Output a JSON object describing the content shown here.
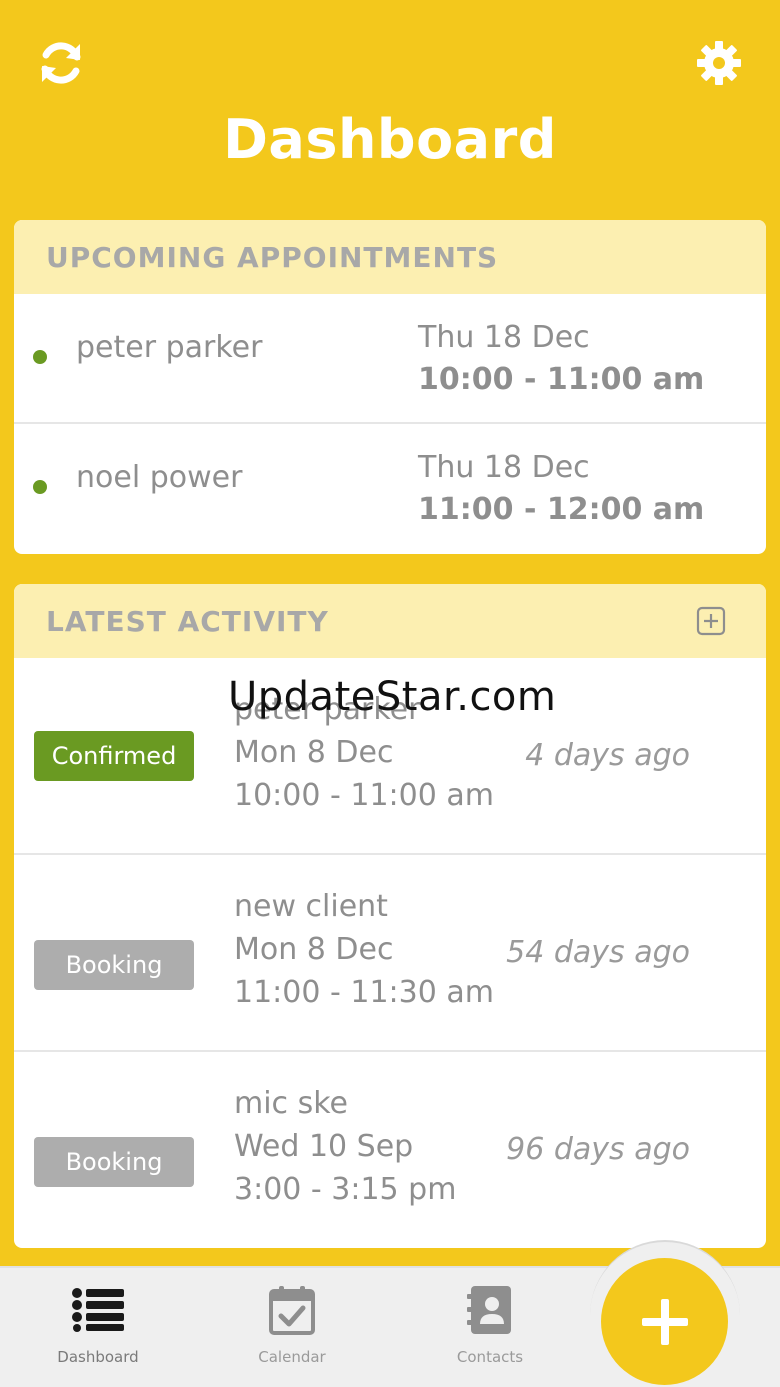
{
  "header": {
    "title": "Dashboard",
    "refresh_icon": "refresh-icon",
    "settings_icon": "gear-icon"
  },
  "appointments": {
    "title": "UPCOMING APPOINTMENTS",
    "items": [
      {
        "name": "peter parker",
        "date": "Thu 18 Dec",
        "time": "10:00 - 11:00 am"
      },
      {
        "name": "noel power",
        "date": "Thu 18 Dec",
        "time": "11:00 - 12:00 am"
      }
    ]
  },
  "activity": {
    "title": "LATEST ACTIVITY",
    "add_icon": "plus-square-icon",
    "items": [
      {
        "status": "Confirmed",
        "name": "peter parker",
        "date": "Mon 8 Dec",
        "time": "10:00 - 11:00 am",
        "ago": "4 days ago"
      },
      {
        "status": "Booking",
        "name": "new client",
        "date": "Mon 8 Dec",
        "time": "11:00 - 11:30 am",
        "ago": "54 days ago"
      },
      {
        "status": "Booking",
        "name": "mic ske",
        "date": "Wed 10 Sep",
        "time": "3:00 - 3:15 pm",
        "ago": "96 days ago"
      }
    ]
  },
  "watermark": "UpdateStar.com",
  "tabs": [
    {
      "label": "Dashboard",
      "icon": "list-icon"
    },
    {
      "label": "Calendar",
      "icon": "calendar-check-icon"
    },
    {
      "label": "Contacts",
      "icon": "contacts-book-icon"
    }
  ],
  "fab": {
    "icon": "plus-icon"
  },
  "colors": {
    "brand": "#f3c81c",
    "header_band": "#fcefb1",
    "confirmed": "#6a9a22",
    "booking": "#adadad"
  }
}
